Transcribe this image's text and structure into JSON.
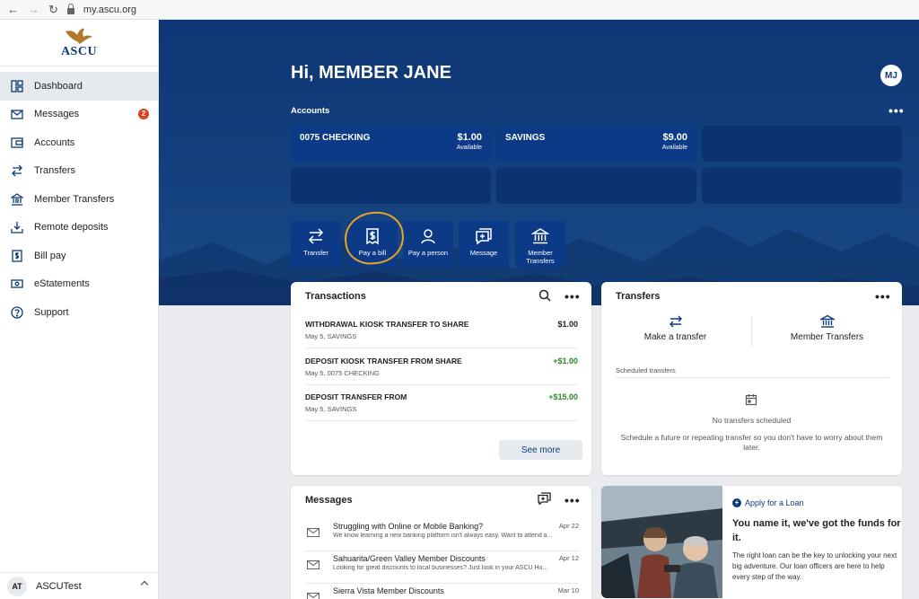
{
  "browser": {
    "url": "my.ascu.org"
  },
  "brand": {
    "logo_text": "ASCU",
    "primary_color": "#0e3a7a",
    "hero_color": "#14407f",
    "accent_color": "#e7a521"
  },
  "sidebar": {
    "items": [
      {
        "label": "Dashboard",
        "icon": "dashboard-icon",
        "active": true
      },
      {
        "label": "Messages",
        "icon": "envelope-icon",
        "badge": "2"
      },
      {
        "label": "Accounts",
        "icon": "wallet-icon"
      },
      {
        "label": "Transfers",
        "icon": "transfer-arrows-icon"
      },
      {
        "label": "Member Transfers",
        "icon": "bank-icon"
      },
      {
        "label": "Remote deposits",
        "icon": "deposit-icon"
      },
      {
        "label": "Bill pay",
        "icon": "bill-icon"
      },
      {
        "label": "eStatements",
        "icon": "statement-icon"
      },
      {
        "label": "Support",
        "icon": "help-icon"
      }
    ],
    "user": {
      "initials": "AT",
      "name": "ASCUTest"
    }
  },
  "hero": {
    "greeting": "Hi, MEMBER JANE",
    "avatar_initials": "MJ",
    "accounts_label": "Accounts",
    "accounts": [
      {
        "name": "0075 CHECKING",
        "balance": "$1.00",
        "status": "Available"
      },
      {
        "name": "SAVINGS",
        "balance": "$9.00",
        "status": "Available"
      }
    ],
    "actions": [
      {
        "label": "Transfer",
        "icon": "transfer-arrows-icon"
      },
      {
        "label": "Pay a bill",
        "icon": "bill-icon"
      },
      {
        "label": "Pay a person",
        "icon": "person-icon"
      },
      {
        "label": "Message",
        "icon": "message-icon"
      },
      {
        "label": "Member Transfers",
        "icon": "bank-icon"
      }
    ]
  },
  "transactions": {
    "title": "Transactions",
    "rows": [
      {
        "description": "WITHDRAWAL KIOSK TRANSFER TO SHARE",
        "meta": "May 5, SAVINGS",
        "amount": "$1.00",
        "positive": false
      },
      {
        "description": "DEPOSIT KIOSK TRANSFER FROM SHARE",
        "meta": "May 5, 0075 CHECKING",
        "amount": "+$1.00",
        "positive": true
      },
      {
        "description": "DEPOSIT TRANSFER FROM",
        "meta": "May 5, SAVINGS",
        "amount": "+$15.00",
        "positive": true
      }
    ],
    "see_more": "See more"
  },
  "transfers": {
    "title": "Transfers",
    "make_transfer": "Make a transfer",
    "member_transfers": "Member Transfers",
    "scheduled_label": "Scheduled transfers",
    "empty_title": "No transfers scheduled",
    "empty_text": "Schedule a future or repeating transfer so you don't have to worry about them later."
  },
  "messages": {
    "title": "Messages",
    "rows": [
      {
        "subject": "Struggling with Online or Mobile Banking?",
        "preview": "We know learning a new banking platform isn't always easy. Want to attend a...",
        "date": "Apr 22"
      },
      {
        "subject": "Sahuarita/Green Valley Member Discounts",
        "preview": "Looking for great discounts to local businesses? Just look in your ASCU Ho...",
        "date": "Apr 12"
      },
      {
        "subject": "Sierra Vista Member Discounts",
        "preview": "",
        "date": "Mar 10"
      }
    ]
  },
  "promo": {
    "link": "Apply for a Loan",
    "headline": "You name it, we've got the funds for it.",
    "body": "The right loan can be the key to unlocking your next big adventure. Our loan officers are here to help every step of the way."
  }
}
